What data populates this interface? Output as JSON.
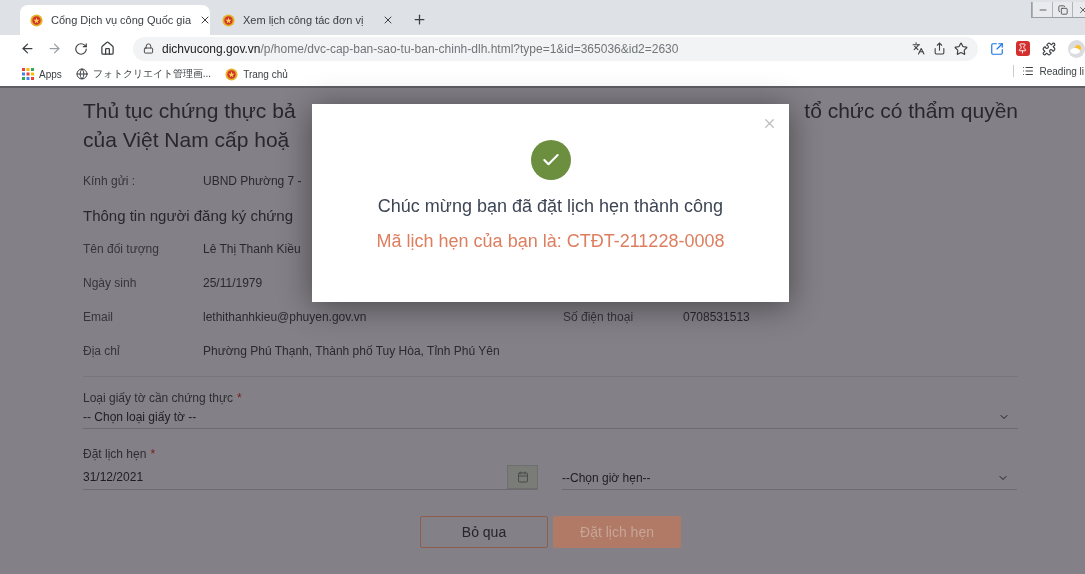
{
  "browser": {
    "tabs": [
      {
        "title": "Cổng Dịch vụ công Quốc gia",
        "selected": true
      },
      {
        "title": "Xem lịch công tác đơn vị",
        "selected": false
      }
    ],
    "url": {
      "host": "dichvucong.gov.vn",
      "path": "/p/home/dvc-cap-ban-sao-tu-ban-chinh-dlh.html?type=1&id=365036&id2=2630"
    },
    "bookmarks": [
      {
        "kind": "apps",
        "label": "Apps"
      },
      {
        "kind": "globe",
        "label": "フォトクリエイト管理画..."
      },
      {
        "kind": "emblem",
        "label": "Trang chủ"
      }
    ],
    "reading_list": "Reading li"
  },
  "page": {
    "title": {
      "line1_left": "Thủ tục chứng thực bả",
      "line1_right": "tổ chức có thẩm quyền",
      "line2_left": "của Việt Nam cấp hoặ"
    },
    "recipient": {
      "label": "Kính gửi :",
      "value": "UBND Phường 7 -"
    },
    "section_heading": "Thông tin người đăng ký chứng",
    "info_rows": [
      [
        {
          "label": "Tên đối tượng",
          "value": "Lê Thị Thanh Kiều"
        }
      ],
      [
        {
          "label": "Ngày sinh",
          "value": "25/11/1979"
        }
      ],
      [
        {
          "label": "Email",
          "value": "lethithanhkieu@phuyen.gov.vn"
        },
        {
          "label": "Số điện thoại",
          "value": "0708531513"
        }
      ],
      [
        {
          "label": "Địa chỉ",
          "value": "Phường Phú Thạnh, Thành phố Tuy Hòa, Tỉnh Phú Yên"
        }
      ]
    ],
    "document_type": {
      "label": "Loại giấy tờ cần chứng thực",
      "required_mark": "*",
      "value": "-- Chọn loại giấy tờ --"
    },
    "appointment": {
      "label": "Đặt lịch hẹn",
      "required_mark": "*",
      "date": "31/12/2021",
      "time": "--Chọn giờ hẹn--"
    },
    "buttons": [
      {
        "label": "Bỏ qua",
        "kind": "outline",
        "disabled": false
      },
      {
        "label": "Đặt lịch hẹn",
        "kind": "primary",
        "disabled": true
      }
    ]
  },
  "modal": {
    "message": "Chúc mừng bạn đã đặt lịch hẹn thành công",
    "code_text": "Mã lịch hẹn của bạn là: CTĐT-211228-0008"
  }
}
